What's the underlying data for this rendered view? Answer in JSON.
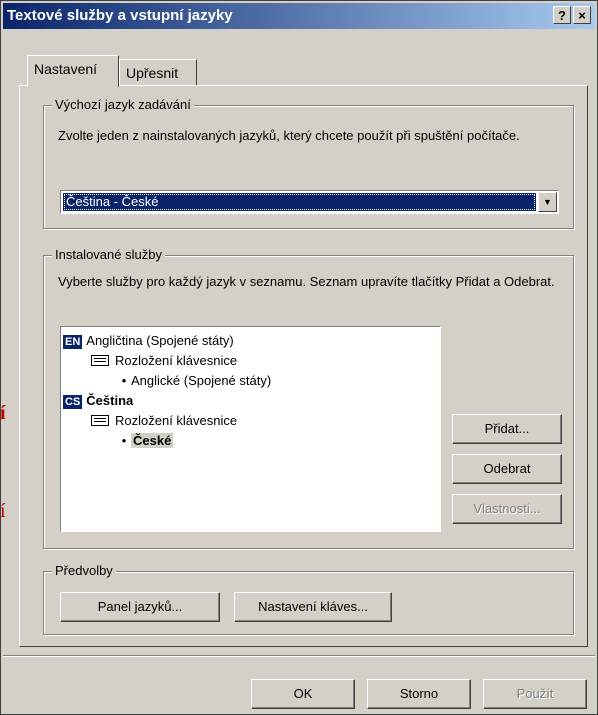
{
  "window": {
    "title": "Textové služby a vstupní jazyky",
    "help_label": "?",
    "close_label": "×"
  },
  "tabs": [
    {
      "label": "Nastavení"
    },
    {
      "label": "Upřesnit"
    }
  ],
  "default_language": {
    "legend": "Výchozí jazyk zadávání",
    "description": "Zvolte jeden z nainstalovaných jazyků, který chcete použít při spuštění počítače.",
    "selected": "Čeština - České",
    "dropdown_arrow": "▼"
  },
  "installed_services": {
    "legend": "Instalované služby",
    "description": "Vyberte služby pro každý jazyk v seznamu. Seznam upravíte tlačítky Přidat a Odebrat.",
    "tree": [
      {
        "badge": "EN",
        "label": "Angličtina (Spojené státy)"
      },
      {
        "label": "Rozložení klávesnice"
      },
      {
        "bullet": "•",
        "label": "Anglické (Spojené státy)"
      },
      {
        "badge": "CS",
        "label": "Čeština"
      },
      {
        "label": "Rozložení klávesnice"
      },
      {
        "bullet": "•",
        "label": "České"
      }
    ],
    "buttons": {
      "add": "Přidat...",
      "remove": "Odebrat",
      "properties": "Vlastnosti..."
    }
  },
  "preferences": {
    "legend": "Předvolby",
    "language_bar": "Panel jazyků...",
    "key_settings": "Nastavení kláves..."
  },
  "footer": {
    "ok": "OK",
    "cancel": "Storno",
    "apply": "Použít"
  },
  "side_marks": [
    "í",
    "í"
  ]
}
